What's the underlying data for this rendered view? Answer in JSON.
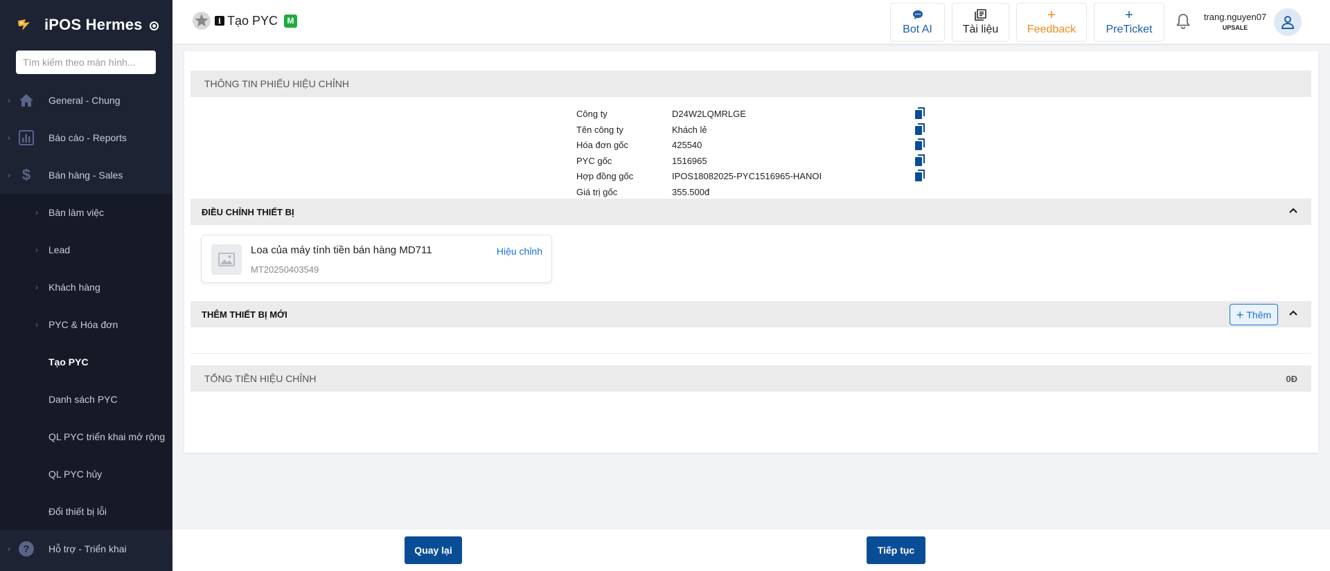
{
  "app": {
    "title": "iPOS Hermes"
  },
  "sidebar": {
    "search_placeholder": "Tìm kiếm theo màn hình...",
    "items": [
      {
        "label": "General - Chung",
        "icon": "home-icon"
      },
      {
        "label": "Báo cáo - Reports",
        "icon": "report-chart-icon"
      },
      {
        "label": "Bán hàng - Sales",
        "icon": "dollar-icon"
      }
    ],
    "sub_items": [
      {
        "label": "Bàn làm việc"
      },
      {
        "label": "Lead"
      },
      {
        "label": "Khách hàng"
      },
      {
        "label": "PYC & Hóa đơn"
      },
      {
        "label": "Tạo PYC",
        "active": true
      },
      {
        "label": "Danh sách PYC"
      },
      {
        "label": "QL PYC triển khai mở rộng"
      },
      {
        "label": "QL PYC hủy"
      },
      {
        "label": "Đổi thiết bị lỗi"
      }
    ],
    "bottom_item": {
      "label": "Hỗ trợ - Triển khai",
      "icon": "help-circle-icon"
    }
  },
  "header": {
    "page_title": "Tạo PYC",
    "badge": "M",
    "buttons": [
      {
        "label": "Bot AI",
        "icon": "chat-bubble-icon",
        "color": "#1a5da8"
      },
      {
        "label": "Tài liệu",
        "icon": "documents-icon",
        "color": "#222222"
      },
      {
        "label": "Feedback",
        "icon": "plus-icon",
        "color": "#f08c1a"
      },
      {
        "label": "PreTicket",
        "icon": "plus-icon",
        "color": "#1a5da8"
      }
    ],
    "user": {
      "name": "trang.nguyen07",
      "role": "UPSALE"
    }
  },
  "info_section": {
    "title": "THÔNG TIN PHIẾU HIỆU CHỈNH",
    "rows": [
      {
        "label": "Công ty",
        "value": "D24W2LQMRLGE",
        "copyable": true
      },
      {
        "label": "Tên công ty",
        "value": "Khách lẻ",
        "copyable": true
      },
      {
        "label": "Hóa đơn gốc",
        "value": "425540",
        "copyable": true
      },
      {
        "label": "PYC gốc",
        "value": "1516965",
        "copyable": true
      },
      {
        "label": "Hợp đồng gốc",
        "value": "IPOS18082025-PYC1516965-HANOI",
        "copyable": true
      },
      {
        "label": "Giá trị gốc",
        "value": "355.500đ",
        "copyable": false
      }
    ]
  },
  "adjust_section": {
    "title": "ĐIỀU CHỈNH THIẾT BỊ",
    "device": {
      "name": "Loa của máy tính tiền bán hàng MD711",
      "code": "MT20250403549",
      "edit_label": "Hiệu chỉnh"
    }
  },
  "new_device_section": {
    "title": "THÊM THIẾT BỊ MỚI",
    "add_label": "Thêm"
  },
  "total_section": {
    "title": "TỔNG TIỀN HIỆU CHỈNH",
    "value": "0Đ"
  },
  "footer": {
    "back_label": "Quay lại",
    "next_label": "Tiếp tục"
  },
  "colors": {
    "sidebar_bg": "#1d2333",
    "primary": "#0a4d97",
    "link": "#1d6fd6",
    "badge_green": "#1eab3d"
  }
}
